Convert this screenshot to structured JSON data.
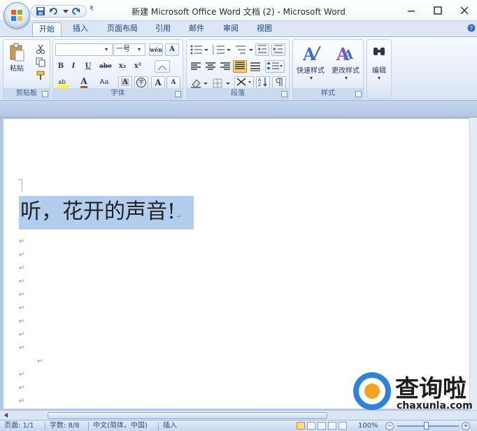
{
  "window": {
    "title": "新建 Microsoft Office Word 文档 (2) - Microsoft Word",
    "qat_customize": "₹"
  },
  "tabs": [
    {
      "label": "开始",
      "active": true
    },
    {
      "label": "插入"
    },
    {
      "label": "页面布局"
    },
    {
      "label": "引用"
    },
    {
      "label": "邮件"
    },
    {
      "label": "审阅"
    },
    {
      "label": "视图"
    }
  ],
  "ribbon": {
    "clipboard": {
      "label": "剪贴板",
      "paste": "粘贴"
    },
    "font": {
      "label": "字体",
      "font_size": "一号",
      "bold": "B",
      "italic": "I",
      "underline": "U",
      "strike": "abe",
      "subscript": "x₂",
      "superscript": "x²",
      "wen": "wén",
      "font_color": "A",
      "change_case": "Aa",
      "char_border": "A",
      "enclose": "字",
      "grow": "A",
      "shrink": "A"
    },
    "paragraph": {
      "label": "段落"
    },
    "styles": {
      "label": "样式",
      "quick_styles": "快速样式",
      "change_styles": "更改样式"
    },
    "editing": {
      "label": "编辑",
      "button": "编辑"
    }
  },
  "document": {
    "text": "听，花开的声音!",
    "para_mark": "↵"
  },
  "status": {
    "page": "页面: 1/1",
    "words": "字数: 8/8",
    "language": "中文(简体，中国)",
    "mode": "插入",
    "zoom": "100%",
    "zoom_minus": "−",
    "zoom_plus": "+"
  },
  "watermark": {
    "cn": "查询啦",
    "en": "chaxunla.com"
  },
  "colors": {
    "accent": "#15428b",
    "selection": "#b3cdef",
    "watermark_blue": "#2f82d8",
    "watermark_orange": "#f3a224"
  }
}
